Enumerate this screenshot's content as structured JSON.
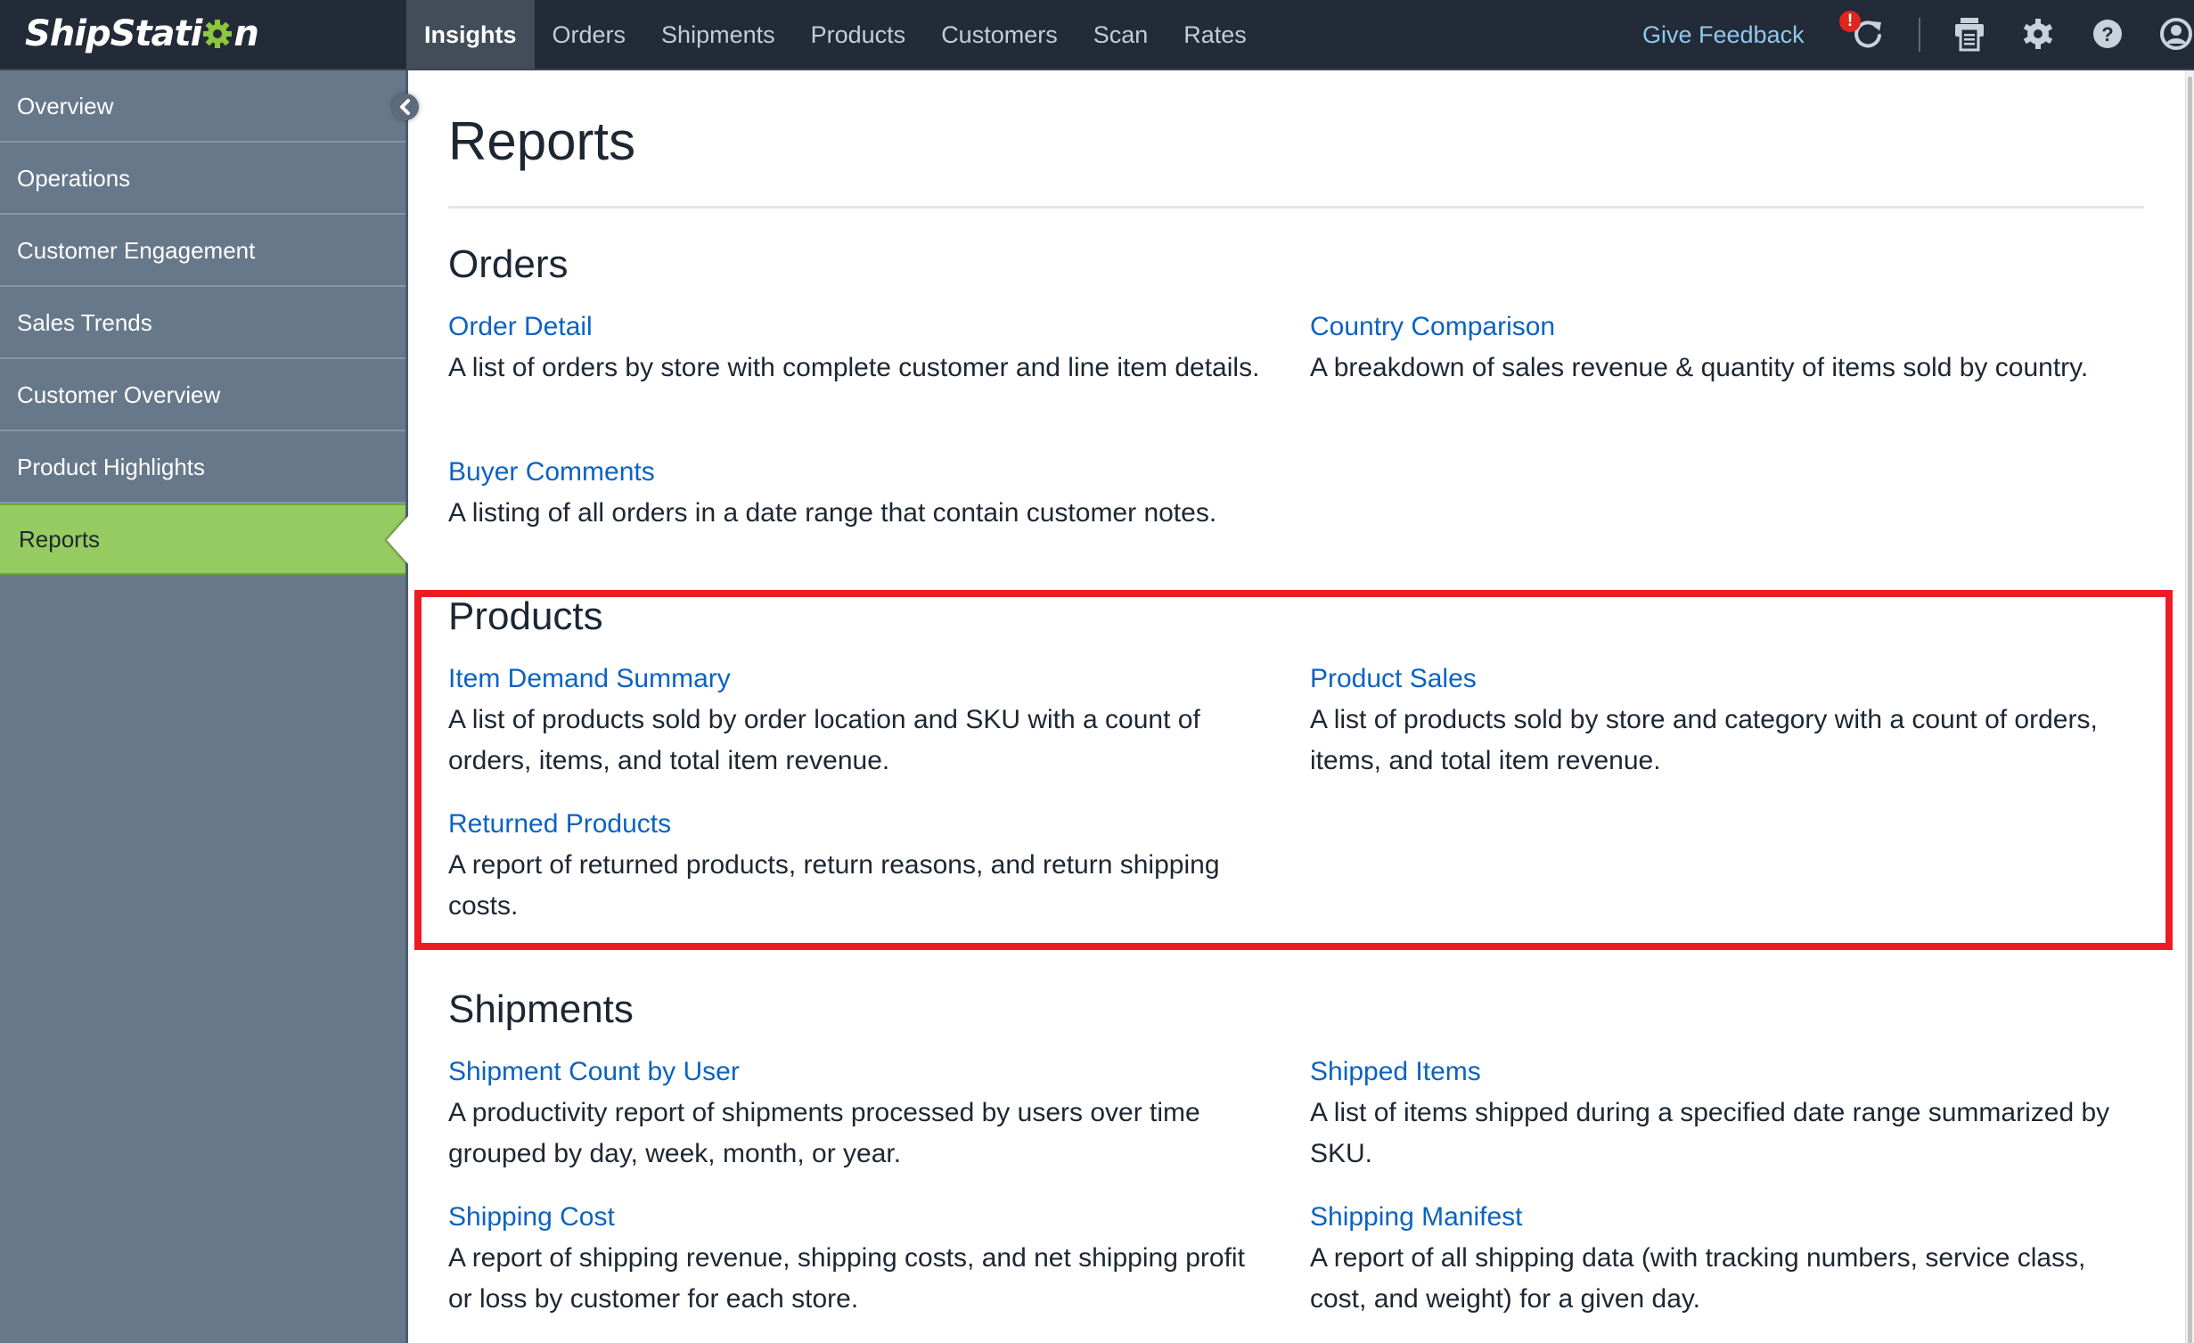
{
  "app": {
    "brand": "ShipStation",
    "brand_parts": {
      "before": "ShipStati",
      "after": "n"
    },
    "brand_gear_color": "#8dc63f"
  },
  "topnav": {
    "items": [
      {
        "label": "Insights",
        "active": true
      },
      {
        "label": "Orders",
        "active": false
      },
      {
        "label": "Shipments",
        "active": false
      },
      {
        "label": "Products",
        "active": false
      },
      {
        "label": "Customers",
        "active": false
      },
      {
        "label": "Scan",
        "active": false
      },
      {
        "label": "Rates",
        "active": false
      }
    ],
    "feedback_label": "Give Feedback",
    "alert_badge": "!",
    "icons": [
      "refresh-icon",
      "printer-icon",
      "gear-icon",
      "help-icon",
      "user-account-icon"
    ]
  },
  "sidebar": {
    "items": [
      {
        "label": "Overview",
        "active": false
      },
      {
        "label": "Operations",
        "active": false
      },
      {
        "label": "Customer Engagement",
        "active": false
      },
      {
        "label": "Sales Trends",
        "active": false
      },
      {
        "label": "Customer Overview",
        "active": false
      },
      {
        "label": "Product Highlights",
        "active": false
      },
      {
        "label": "Reports",
        "active": true
      }
    ],
    "collapse_icon": "chevron-left-icon"
  },
  "main": {
    "title": "Reports",
    "sections": [
      {
        "title": "Orders",
        "reports": [
          {
            "name": "Order Detail",
            "description": "A list of orders by store with complete customer and line item details."
          },
          {
            "name": "Country Comparison",
            "description": "A breakdown of sales revenue & quantity of items sold by country."
          },
          {
            "name": "Buyer Comments",
            "description": "A listing of all orders in a date range that contain customer notes."
          }
        ]
      },
      {
        "title": "Products",
        "highlighted": true,
        "reports": [
          {
            "name": "Item Demand Summary",
            "description": "A list of products sold by order location and SKU with a count of orders, items, and total item revenue."
          },
          {
            "name": "Product Sales",
            "description": "A list of products sold by store and category with a count of orders, items, and total item revenue."
          },
          {
            "name": "Returned Products",
            "description": "A report of returned products, return reasons, and return shipping costs."
          }
        ]
      },
      {
        "title": "Shipments",
        "reports": [
          {
            "name": "Shipment Count by User",
            "description": "A productivity report of shipments processed by users over time grouped by day, week, month, or year."
          },
          {
            "name": "Shipped Items",
            "description": "A list of items shipped during a specified date range summarized by SKU."
          },
          {
            "name": "Shipping Cost",
            "description": "A report of shipping revenue, shipping costs, and net shipping profit or loss by customer for each store."
          },
          {
            "name": "Shipping Manifest",
            "description": "A report of all shipping data (with tracking numbers, service class, cost, and weight) for a given day."
          }
        ]
      }
    ]
  },
  "colors": {
    "topbar": "#222b37",
    "active_tab": "#434d59",
    "sidebar": "#66788a",
    "sidebar_active": "#96cb61",
    "link": "#0b63c1",
    "feedback": "#8fc8ee",
    "highlight_border": "#ed1c24",
    "alert": "#e0261d"
  }
}
